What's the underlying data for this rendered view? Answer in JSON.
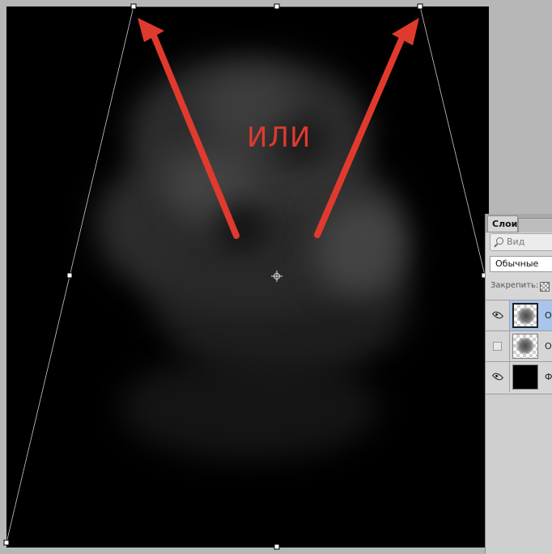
{
  "annotation": {
    "label": "ИЛИ",
    "arrow_color": "#e03a2e"
  },
  "layers_panel": {
    "tab_label": "Слои",
    "search_placeholder": "Вид",
    "blend_mode": "Обычные",
    "lock_label": "Закрепить:",
    "layers": [
      {
        "name": "О",
        "visible": true,
        "selected": true,
        "thumbnail": "cloud-transparent"
      },
      {
        "name": "О",
        "visible": false,
        "selected": false,
        "thumbnail": "cloud-transparent"
      },
      {
        "name": "Ф",
        "visible": true,
        "selected": false,
        "thumbnail": "black-fill"
      }
    ],
    "icons": {
      "search": "search-icon",
      "eye": "eye-icon",
      "lock_transparency": "lock-transparency-icon"
    }
  }
}
